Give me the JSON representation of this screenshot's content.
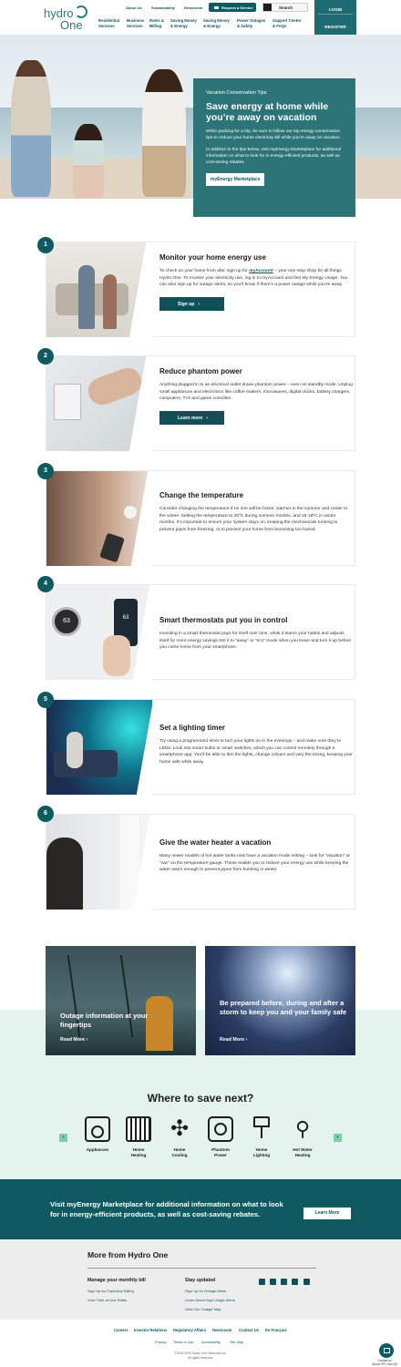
{
  "header": {
    "logo_line1": "hydro",
    "logo_line2": "One",
    "util_links": [
      "About Us",
      "Sustainability",
      "Newsroom"
    ],
    "request_service": "Request a Service",
    "search": "Search",
    "nav": [
      {
        "l1": "Residential",
        "l2": "Services"
      },
      {
        "l1": "Business",
        "l2": "Services"
      },
      {
        "l1": "Rates &",
        "l2": "Billing"
      },
      {
        "l1": "Saving Money",
        "l2": "& Energy"
      },
      {
        "l1": "Saving Money",
        "l2": "& Energy"
      },
      {
        "l1": "Power Outages",
        "l2": "& Safety"
      },
      {
        "l1": "Support Centre",
        "l2": "& FAQs"
      }
    ],
    "login": "LOGIN",
    "register": "REGISTER"
  },
  "hero": {
    "kicker": "Vacation Conservation Tips",
    "title": "Save energy at home while you’re away on vacation",
    "p1": "While packing for a trip, be sure to follow our top energy conservation tips to reduce your home electricity bill while you’re away on vacation.",
    "p2": "In addition to the tips below, visit myEnergy Marketplace for additional information on what to look for in energy-efficient products, as well as cost-saving rebates.",
    "button": "myEnergy Marketplace"
  },
  "tips": [
    {
      "num": "1",
      "title": "Monitor your home energy use",
      "pre": "To check on your home from afar, sign up for ",
      "link": "myAccount",
      "text": " – your one-stop shop for all things Hydro One. To monitor your electricity use, log in to myAccount and find My Energy Usage. You can also sign up for outage alerts, so you’ll know if there’s a power outage while you’re away.",
      "button": "Sign up"
    },
    {
      "num": "2",
      "title": "Reduce phantom power",
      "pre": "",
      "link": "",
      "text": "Anything plugged in to an electrical outlet draws phantom power – even on standby mode. Unplug small appliances and electronics like coffee makers, microwaves, digital clocks, battery chargers, computers, TVs and game consoles.",
      "button": "Learn more"
    },
    {
      "num": "3",
      "title": "Change the temperature",
      "pre": "",
      "link": "",
      "text": "Consider changing the temperature if no one will be home; warmer in the summer and cooler in the winter. Setting the temperature to 25ºC during summer months, and 16-18ºC in winter months. It’s important to ensure your system stays on, keeping the mechanicals running to prevent pipes from freezing, or to prevent your home from becoming too humid.",
      "button": ""
    },
    {
      "num": "4",
      "title": "Smart thermostats put you in control",
      "pre": "",
      "link": "",
      "text": "Investing in a smart thermostat pays for itself over time, while it learns your habits and adjusts itself for more energy savings.Set it to “away” or “eco” mode when you leave and turn it up before you come home from your smartphone.",
      "button": ""
    },
    {
      "num": "5",
      "title": "Set a lighting timer",
      "pre": "",
      "link": "",
      "text": "Try using a programmed timer to turn your lights on in the evenings – and make sure they’re LEDs. Look into smart bulbs or smart switches, which you can control remotely through a smartphone app. You’ll be able to dim the lights, change colours and vary the timing, keeping your home safe while away.",
      "button": ""
    },
    {
      "num": "6",
      "title": "Give the water heater a vacation",
      "pre": "",
      "link": "",
      "text": "Many newer models of hot water tanks now have a vacation mode setting – look for “vacation” or “vac” on the temperature gauge. These enable you to reduce your energy use while keeping the water warm enough to prevent pipes from bursting in winter.",
      "button": ""
    }
  ],
  "thermostat_reading": "63",
  "promos": [
    {
      "title": "Outage information at your fingertips",
      "link": "Read More"
    },
    {
      "title": "Be prepared before, during and after a storm to keep you and your family safe",
      "link": "Read More"
    }
  ],
  "where": {
    "title": "Where to save next?",
    "items": [
      {
        "l1": "Appliances",
        "l2": ""
      },
      {
        "l1": "Home",
        "l2": "Heating"
      },
      {
        "l1": "Home",
        "l2": "Cooling"
      },
      {
        "l1": "Phantom",
        "l2": "Power"
      },
      {
        "l1": "Home",
        "l2": "Lighting"
      },
      {
        "l1": "Hot Water",
        "l2": "Heating"
      }
    ]
  },
  "banner": {
    "text": "Visit myEnergy Marketplace for additional information on what to look for in energy-efficient products, as well as cost-saving rebates.",
    "button": "Learn More"
  },
  "more": {
    "title": "More from Hydro One",
    "col1_title": "Manage your monthly bill",
    "col1_links": [
      "Sign Up for Paperless Billing",
      "View Time-of-Use Rates"
    ],
    "col2_title": "Stay updated",
    "col2_links": [
      "Sign Up for Outage Alerts",
      "Learn About High Usage Alerts",
      "View Our Outage Map"
    ]
  },
  "footer": {
    "links": [
      "Careers",
      "Investor Relations",
      "Regulatory Affairs",
      "Newsroom",
      "Contact Us",
      "En Français"
    ],
    "legal": [
      "Privacy",
      "Terms of Use",
      "Accessibility",
      "Site Map"
    ],
    "copy1": "©2018-2020 Hydro One Networks Inc.",
    "copy2": "All rights reserved.",
    "contact1": "Contact us",
    "contact2": "Above 970 Own Q5"
  },
  "colors": {
    "brand": "#0f5a61",
    "hero_card": "#2c7477",
    "mint": "#e5f3ef",
    "accent": "#7fcfa4"
  }
}
